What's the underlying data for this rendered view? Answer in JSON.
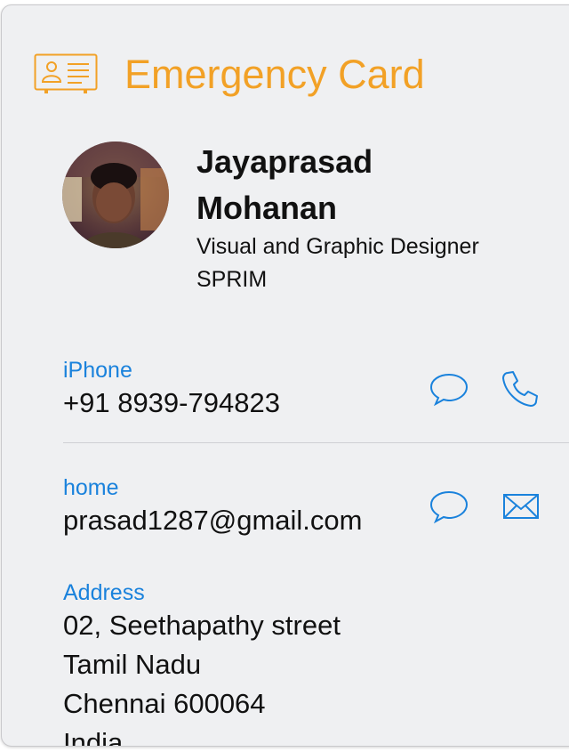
{
  "header": {
    "title": "Emergency Card",
    "icon": "contact-card-icon",
    "accent_color": "#f2a126"
  },
  "contact": {
    "first_name": "Jayaprasad",
    "last_name": "Mohanan",
    "job_title": "Visual and Graphic Designer",
    "organization": "SPRIM",
    "avatar": "profile-photo"
  },
  "phone": {
    "label": "iPhone",
    "value": "+91 8939-794823",
    "actions": [
      "message-icon",
      "phone-icon"
    ]
  },
  "email": {
    "label": "home",
    "value": "prasad1287@gmail.com",
    "actions": [
      "message-icon",
      "mail-icon"
    ]
  },
  "address": {
    "label": "Address",
    "line1": "02, Seethapathy street",
    "line2": "Tamil Nadu",
    "line3": "Chennai 600064",
    "line4": "India"
  },
  "colors": {
    "label_blue": "#1a82dc",
    "background": "#eff0f2"
  }
}
